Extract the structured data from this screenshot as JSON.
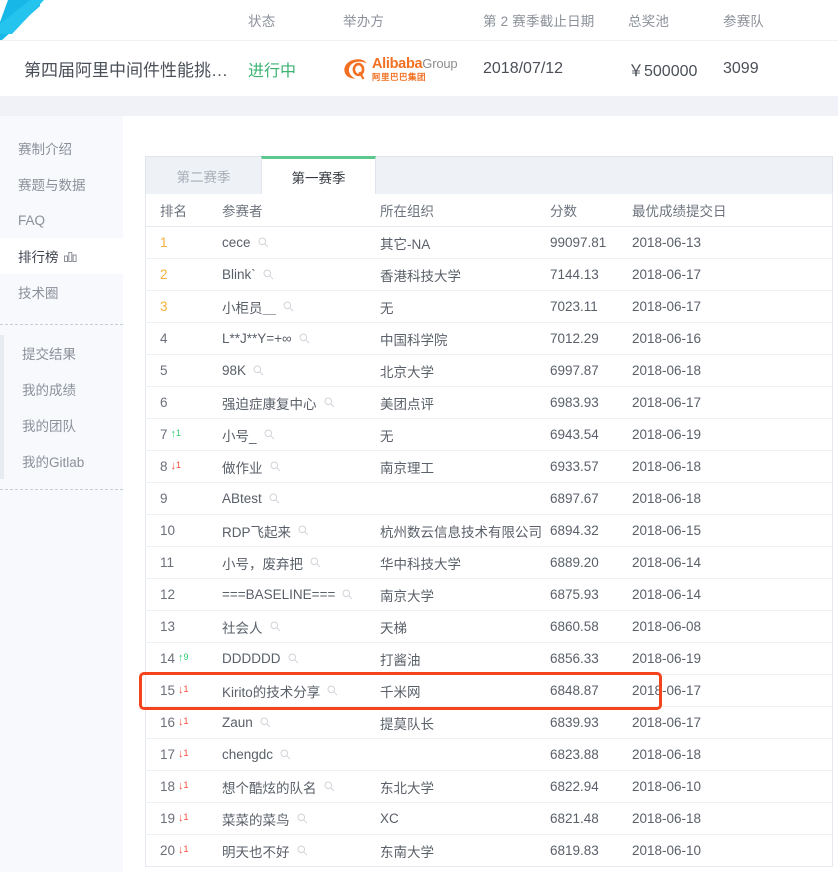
{
  "banner": {
    "headers": [
      "",
      "状态",
      "举办方",
      "第 2 赛季截止日期",
      "总奖池",
      "参赛队"
    ],
    "title": "第四届阿里中间件性能挑…",
    "status": "进行中",
    "host_logo": {
      "word": "Alibaba",
      "group": "Group",
      "cn": "阿里巴巴集团"
    },
    "deadline": "2018/07/12",
    "prize_pool": "￥500000",
    "teams": "3099"
  },
  "sidebar": {
    "upper_items": [
      {
        "label": "赛制介绍",
        "active": false,
        "icon": ""
      },
      {
        "label": "赛题与数据",
        "active": false,
        "icon": ""
      },
      {
        "label": "FAQ",
        "active": false,
        "icon": ""
      },
      {
        "label": "排行榜",
        "active": true,
        "icon": "bar-chart-icon"
      },
      {
        "label": "技术圈",
        "active": false,
        "icon": ""
      }
    ],
    "lower_items": [
      {
        "label": "提交结果",
        "active": false,
        "icon": ""
      },
      {
        "label": "我的成绩",
        "active": false,
        "icon": ""
      },
      {
        "label": "我的团队",
        "active": false,
        "icon": ""
      },
      {
        "label": "我的Gitlab",
        "active": false,
        "icon": ""
      }
    ]
  },
  "tabs": [
    {
      "label": "第二赛季",
      "active": false
    },
    {
      "label": "第一赛季",
      "active": true
    }
  ],
  "table": {
    "headers": [
      "排名",
      "参赛者",
      "所在组织",
      "分数",
      "最优成绩提交日"
    ],
    "rows": [
      {
        "rank": "1",
        "delta": "",
        "dir": "",
        "name": "cece",
        "org": "其它-NA",
        "score": "99097.81",
        "date": "2018-06-13",
        "gold": true,
        "highlight": false
      },
      {
        "rank": "2",
        "delta": "",
        "dir": "",
        "name": "Blink`",
        "org": "香港科技大学",
        "score": "7144.13",
        "date": "2018-06-17",
        "gold": true,
        "highlight": false
      },
      {
        "rank": "3",
        "delta": "",
        "dir": "",
        "name": "小柜员＿",
        "org": "无",
        "score": "7023.11",
        "date": "2018-06-17",
        "gold": true,
        "highlight": false
      },
      {
        "rank": "4",
        "delta": "",
        "dir": "",
        "name": "L**J**Y=+∞",
        "org": "中国科学院",
        "score": "7012.29",
        "date": "2018-06-16",
        "gold": false,
        "highlight": false
      },
      {
        "rank": "5",
        "delta": "",
        "dir": "",
        "name": "98K",
        "org": "北京大学",
        "score": "6997.87",
        "date": "2018-06-18",
        "gold": false,
        "highlight": false
      },
      {
        "rank": "6",
        "delta": "",
        "dir": "",
        "name": "强迫症康复中心",
        "org": "美团点评",
        "score": "6983.93",
        "date": "2018-06-17",
        "gold": false,
        "highlight": false
      },
      {
        "rank": "7",
        "delta": "1",
        "dir": "up",
        "name": "小号_",
        "org": "无",
        "score": "6943.54",
        "date": "2018-06-19",
        "gold": false,
        "highlight": false
      },
      {
        "rank": "8",
        "delta": "1",
        "dir": "down",
        "name": "做作业",
        "org": "南京理工",
        "score": "6933.57",
        "date": "2018-06-18",
        "gold": false,
        "highlight": false
      },
      {
        "rank": "9",
        "delta": "",
        "dir": "",
        "name": "ABtest",
        "org": "",
        "score": "6897.67",
        "date": "2018-06-18",
        "gold": false,
        "highlight": false
      },
      {
        "rank": "10",
        "delta": "",
        "dir": "",
        "name": "RDP飞起来",
        "org": "杭州数云信息技术有限公司",
        "score": "6894.32",
        "date": "2018-06-15",
        "gold": false,
        "highlight": false
      },
      {
        "rank": "11",
        "delta": "",
        "dir": "",
        "name": "小号，废弃把",
        "org": "华中科技大学",
        "score": "6889.20",
        "date": "2018-06-14",
        "gold": false,
        "highlight": false
      },
      {
        "rank": "12",
        "delta": "",
        "dir": "",
        "name": "===BASELINE===",
        "org": "南京大学",
        "score": "6875.93",
        "date": "2018-06-14",
        "gold": false,
        "highlight": false
      },
      {
        "rank": "13",
        "delta": "",
        "dir": "",
        "name": "社会人",
        "org": "天梯",
        "score": "6860.58",
        "date": "2018-06-08",
        "gold": false,
        "highlight": false
      },
      {
        "rank": "14",
        "delta": "9",
        "dir": "up",
        "name": "DDDDDD",
        "org": "打酱油",
        "score": "6856.33",
        "date": "2018-06-19",
        "gold": false,
        "highlight": false
      },
      {
        "rank": "15",
        "delta": "1",
        "dir": "down",
        "name": "Kirito的技术分享",
        "org": "千米网",
        "score": "6848.87",
        "date": "2018-06-17",
        "gold": false,
        "highlight": true
      },
      {
        "rank": "16",
        "delta": "1",
        "dir": "down",
        "name": "Zaun",
        "org": "提莫队长",
        "score": "6839.93",
        "date": "2018-06-17",
        "gold": false,
        "highlight": false
      },
      {
        "rank": "17",
        "delta": "1",
        "dir": "down",
        "name": "chengdc",
        "org": "",
        "score": "6823.88",
        "date": "2018-06-18",
        "gold": false,
        "highlight": false
      },
      {
        "rank": "18",
        "delta": "1",
        "dir": "down",
        "name": "想个酷炫的队名",
        "org": "东北大学",
        "score": "6822.94",
        "date": "2018-06-10",
        "gold": false,
        "highlight": false
      },
      {
        "rank": "19",
        "delta": "1",
        "dir": "down",
        "name": "菜菜的菜鸟",
        "org": "XC",
        "score": "6821.48",
        "date": "2018-06-18",
        "gold": false,
        "highlight": false
      },
      {
        "rank": "20",
        "delta": "1",
        "dir": "down",
        "name": "明天也不好",
        "org": "东南大学",
        "score": "6819.83",
        "date": "2018-06-10",
        "gold": false,
        "highlight": false
      }
    ]
  },
  "colors": {
    "accent_green": "#5cc88b",
    "status_green": "#3cb371",
    "gold": "#f5b13d",
    "highlight_red": "#f4441e",
    "brand_orange": "#f36f21",
    "logo_cyan": "#17b8e8",
    "page_grey": "#f0f2f7",
    "sidebar_bg": "#f7f9fc"
  }
}
